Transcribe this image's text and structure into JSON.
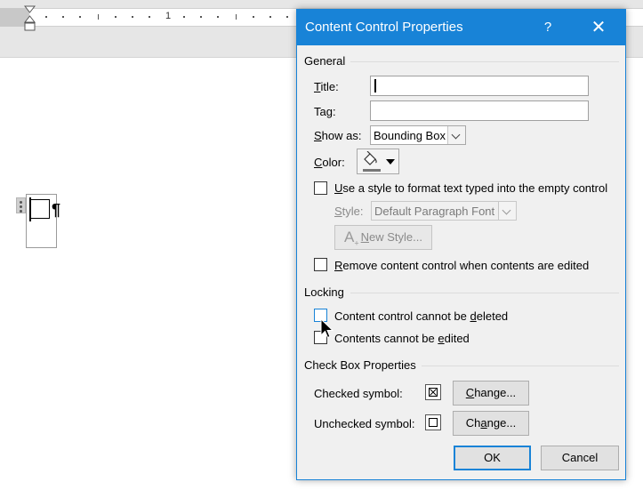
{
  "ruler": {
    "number": "1"
  },
  "document": {
    "pilcrow": "¶"
  },
  "dialog": {
    "title": "Content Control Properties",
    "help_glyph": "?",
    "close_glyph": "✕",
    "general": {
      "heading": "General",
      "title_label": {
        "pre": "",
        "key": "T",
        "post": "itle:"
      },
      "title_value": "",
      "tag_label": {
        "pre": "Ta",
        "key": "g",
        "post": ":"
      },
      "tag_value": "",
      "show_as_label": {
        "pre": "",
        "key": "S",
        "post": "how as:"
      },
      "show_as_value": "Bounding Box",
      "color_label": {
        "pre": "",
        "key": "C",
        "post": "olor:"
      },
      "use_style_label": {
        "pre": "",
        "key": "U",
        "post": "se a style to format text typed into the empty control"
      },
      "use_style_checked": false,
      "style_label": {
        "pre": "",
        "key": "S",
        "post": "tyle:"
      },
      "style_value": "Default Paragraph Font",
      "new_style_button": {
        "pre": "",
        "key": "N",
        "post": "ew Style..."
      },
      "remove_label": {
        "pre": "",
        "key": "R",
        "post": "emove content control when contents are edited"
      },
      "remove_checked": false
    },
    "locking": {
      "heading": "Locking",
      "cannot_delete_label": {
        "pre": "Content control cannot be ",
        "key": "d",
        "post": "eleted"
      },
      "cannot_delete_checked": false,
      "cannot_edit_label": {
        "pre": "Contents cannot be ",
        "key": "e",
        "post": "dited"
      },
      "cannot_edit_checked": false
    },
    "checkbox_props": {
      "heading": "Check Box Properties",
      "checked_symbol_label": "Checked symbol:",
      "checked_symbol_glyph": "☒",
      "unchecked_symbol_label": "Unchecked symbol:",
      "unchecked_symbol_glyph": "☐",
      "change_button_1": {
        "pre": "",
        "key": "C",
        "post": "hange..."
      },
      "change_button_2": {
        "pre": "Ch",
        "key": "a",
        "post": "nge..."
      }
    },
    "ok_label": "OK",
    "cancel_label": "Cancel"
  },
  "colors": {
    "accent": "#1883d7",
    "dialog_bg": "#f0f0f0",
    "disabled_text": "#8a8a8a"
  },
  "icons": {
    "help": "question-icon",
    "close": "close-icon",
    "color_picker": "paint-bucket-icon",
    "new_style": "new-style-icon",
    "cursor": "mouse-pointer-icon"
  }
}
